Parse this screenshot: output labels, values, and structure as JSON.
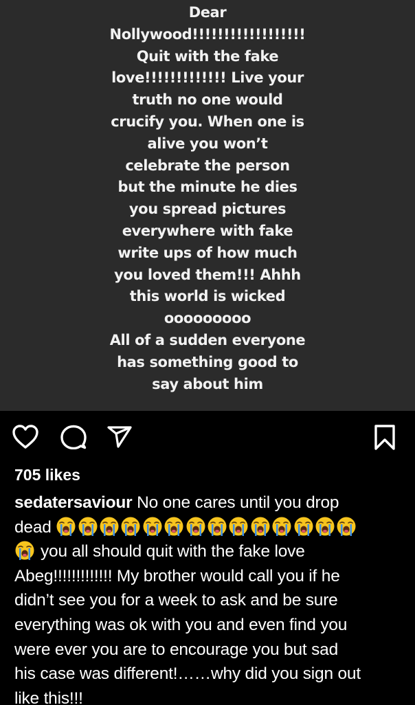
{
  "story": {
    "lines": [
      "Dear",
      "Nollywood!!!!!!!!!!!!!!!!!!",
      "Quit with the fake",
      "love!!!!!!!!!!!!! Live your",
      "truth no one would",
      "crucify you. When one is",
      "alive you won’t",
      "celebrate the person",
      "but the minute he dies",
      "you spread pictures",
      "everywhere with fake",
      "write ups of how much",
      "you loved them!!! Ahhh",
      "this world is wicked",
      "ooooooooo",
      "All of a sudden everyone",
      "has something good to",
      "say about him"
    ]
  },
  "actions": {
    "like_icon": "heart-outline-icon",
    "comment_icon": "speech-bubble-icon",
    "share_icon": "paper-plane-icon",
    "save_icon": "bookmark-icon"
  },
  "post": {
    "likes": "705 likes",
    "username": "sedatersaviour",
    "caption_first": " No one cares until you drop",
    "caption_dead": "dead ",
    "emoji_name": "loudly-crying-face",
    "emoji_count": 14,
    "caption_lines": [
      " you all should quit with the fake love",
      "Abeg!!!!!!!!!!!!! My brother would call you if he",
      "didn’t see you for a week to ask and be sure",
      "everything was ok with you and even find you",
      "were ever you are to encourage you but sad",
      "his case was different!……why did you sign out",
      "like this!!!"
    ]
  },
  "colors": {
    "story_bg": "#2b2b2b",
    "page_bg": "#000000",
    "text": "#ffffff",
    "emoji_face": "#f7c51e",
    "emoji_tears": "#3b8ee8"
  }
}
